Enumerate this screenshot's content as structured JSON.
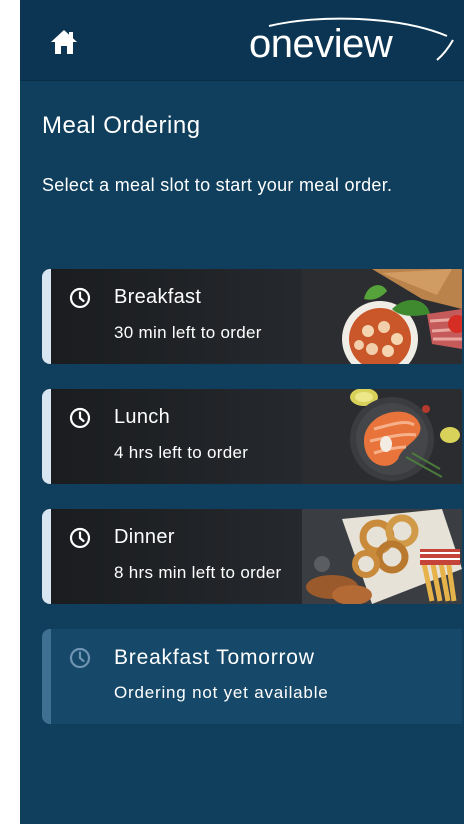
{
  "header": {
    "home_icon": "home-icon",
    "logo_text": "oneview"
  },
  "page": {
    "title": "Meal Ordering",
    "subtitle": "Select a meal slot to start your meal order."
  },
  "meal_slots": [
    {
      "name": "Breakfast",
      "status": "30 min left to order",
      "icon": "clock-icon",
      "available": true
    },
    {
      "name": "Lunch",
      "status": "4 hrs left to order",
      "icon": "clock-icon",
      "available": true
    },
    {
      "name": "Dinner",
      "status": "8 hrs min left to order",
      "icon": "clock-icon",
      "available": true
    },
    {
      "name": "Breakfast Tomorrow",
      "status": "Ordering not yet available",
      "icon": "clock-icon",
      "available": false
    }
  ],
  "colors": {
    "background": "#0f3f5c",
    "header": "#0b3552",
    "accent_active": "#d7e6f1",
    "accent_disabled": "#3f6f91",
    "card_disabled": "#164869"
  }
}
